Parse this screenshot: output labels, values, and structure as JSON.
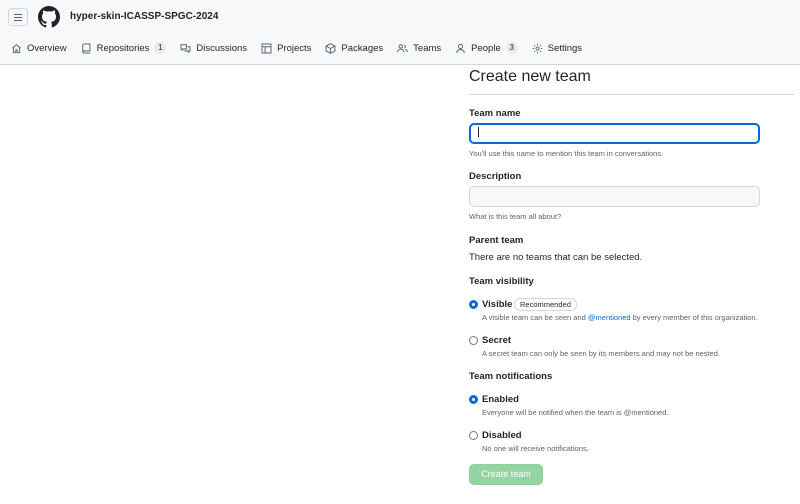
{
  "header": {
    "org_name": "hyper-skin-ICASSP-SPGC-2024",
    "menu_icon": "hamburger-icon",
    "logo_icon": "github-logo-icon"
  },
  "nav": {
    "items": [
      {
        "label": "Overview",
        "icon": "home-icon"
      },
      {
        "label": "Repositories",
        "icon": "repo-icon",
        "count": "1"
      },
      {
        "label": "Discussions",
        "icon": "comment-discussion-icon"
      },
      {
        "label": "Projects",
        "icon": "table-icon"
      },
      {
        "label": "Packages",
        "icon": "package-icon"
      },
      {
        "label": "Teams",
        "icon": "people-icon"
      },
      {
        "label": "People",
        "icon": "person-icon",
        "count": "3"
      },
      {
        "label": "Settings",
        "icon": "gear-icon"
      }
    ]
  },
  "form": {
    "title": "Create new team",
    "team_name": {
      "label": "Team name",
      "value": "",
      "hint": "You'll use this name to mention this team in conversations."
    },
    "description": {
      "label": "Description",
      "value": "",
      "hint": "What is this team all about?"
    },
    "parent_team": {
      "label": "Parent team",
      "text": "There are no teams that can be selected."
    },
    "visibility": {
      "label": "Team visibility",
      "options": [
        {
          "label": "Visible",
          "badge": "Recommended",
          "desc_before": "A visible team can be seen and ",
          "desc_link": "@mentioned",
          "desc_after": " by every member of this organization.",
          "checked": true
        },
        {
          "label": "Secret",
          "desc": "A secret team can only be seen by its members and may not be nested.",
          "checked": false
        }
      ]
    },
    "notifications": {
      "label": "Team notifications",
      "options": [
        {
          "label": "Enabled",
          "desc": "Everyone will be notified when the team is @mentioned.",
          "checked": true
        },
        {
          "label": "Disabled",
          "desc": "No one will receive notifications.",
          "checked": false
        }
      ]
    },
    "submit_label": "Create team"
  },
  "colors": {
    "accent": "#0969da",
    "submit_disabled": "#94d3a2",
    "header_bg": "#f6f8fa",
    "border": "#d0d7de"
  }
}
